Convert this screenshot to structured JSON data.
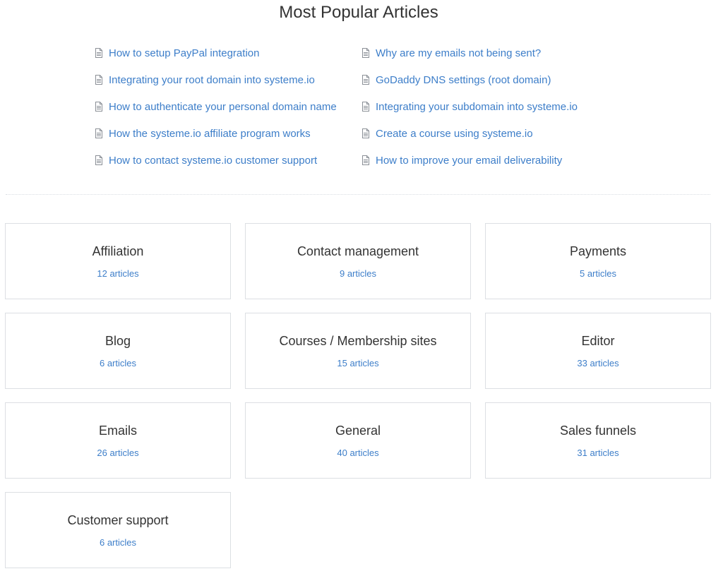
{
  "header": {
    "title": "Most Popular Articles"
  },
  "popular_articles": {
    "left": [
      "How to setup PayPal integration",
      "Integrating your root domain into systeme.io",
      "How to authenticate your personal domain name",
      "How the systeme.io affiliate program works",
      "How to contact systeme.io customer support"
    ],
    "right": [
      "Why are my emails not being sent?",
      "GoDaddy DNS settings (root domain)",
      "Integrating your subdomain into systeme.io",
      "Create a course using systeme.io",
      "How to improve your email deliverability"
    ],
    "icon": "document-icon"
  },
  "categories": [
    {
      "name": "Affiliation",
      "count": "12 articles"
    },
    {
      "name": "Contact management",
      "count": "9 articles"
    },
    {
      "name": "Payments",
      "count": "5 articles"
    },
    {
      "name": "Blog",
      "count": "6 articles"
    },
    {
      "name": "Courses / Membership sites",
      "count": "15 articles"
    },
    {
      "name": "Editor",
      "count": "33 articles"
    },
    {
      "name": "Emails",
      "count": "26 articles"
    },
    {
      "name": "General",
      "count": "40 articles"
    },
    {
      "name": "Sales funnels",
      "count": "31 articles"
    },
    {
      "name": "Customer support",
      "count": "6 articles"
    }
  ],
  "colors": {
    "link": "#3d7ec9",
    "text": "#333333",
    "border": "#dcdfe3"
  }
}
